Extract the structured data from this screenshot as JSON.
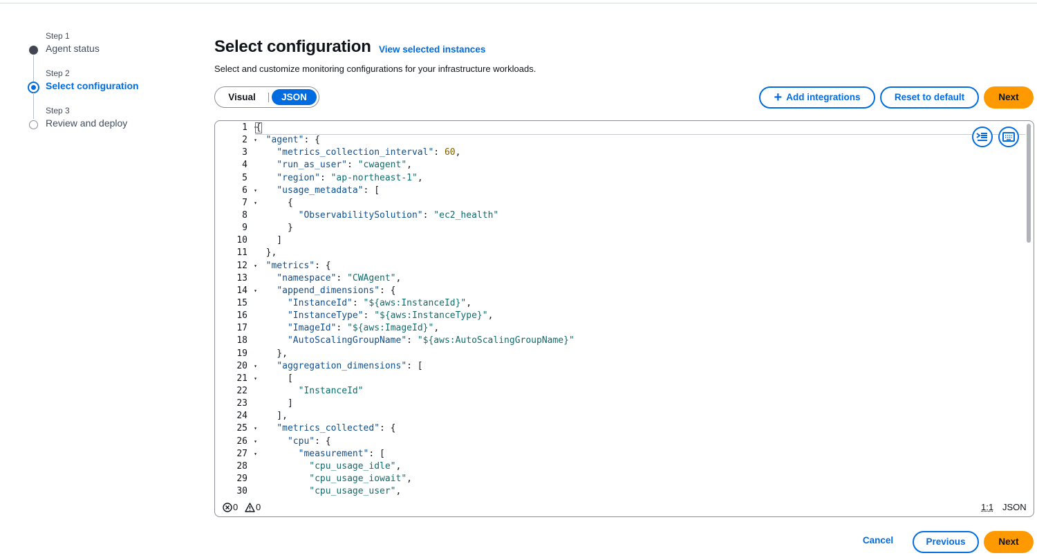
{
  "steps": [
    {
      "caption": "Step 1",
      "title": "Agent status"
    },
    {
      "caption": "Step 2",
      "title": "Select configuration"
    },
    {
      "caption": "Step 3",
      "title": "Review and deploy"
    }
  ],
  "header": {
    "title": "Select configuration",
    "link": "View selected instances",
    "description": "Select and customize monitoring configurations for your infrastructure workloads."
  },
  "toggle": {
    "visual": "Visual",
    "json": "JSON",
    "selected": "JSON"
  },
  "actions": {
    "add": "Add integrations",
    "reset": "Reset to default",
    "next": "Next"
  },
  "editor": {
    "line_numbers": [
      "1",
      "2",
      "3",
      "4",
      "5",
      "6",
      "7",
      "8",
      "9",
      "10",
      "11",
      "12",
      "13",
      "14",
      "15",
      "16",
      "17",
      "18",
      "19",
      "20",
      "21",
      "22",
      "23",
      "24",
      "25",
      "26",
      "27",
      "28",
      "29",
      "30"
    ],
    "foldable_lines": [
      1,
      2,
      6,
      7,
      12,
      14,
      20,
      21,
      25,
      26,
      27
    ],
    "lines": [
      "{",
      "  \"agent\": {",
      "    \"metrics_collection_interval\": 60,",
      "    \"run_as_user\": \"cwagent\",",
      "    \"region\": \"ap-northeast-1\",",
      "    \"usage_metadata\": [",
      "      {",
      "        \"ObservabilitySolution\": \"ec2_health\"",
      "      }",
      "    ]",
      "  },",
      "  \"metrics\": {",
      "    \"namespace\": \"CWAgent\",",
      "    \"append_dimensions\": {",
      "      \"InstanceId\": \"${aws:InstanceId}\",",
      "      \"InstanceType\": \"${aws:InstanceType}\",",
      "      \"ImageId\": \"${aws:ImageId}\",",
      "      \"AutoScalingGroupName\": \"${aws:AutoScalingGroupName}\"",
      "    },",
      "    \"aggregation_dimensions\": [",
      "      [",
      "        \"InstanceId\"",
      "      ]",
      "    ],",
      "    \"metrics_collected\": {",
      "      \"cpu\": {",
      "        \"measurement\": [",
      "          \"cpu_usage_idle\",",
      "          \"cpu_usage_iowait\",",
      "          \"cpu_usage_user\","
    ],
    "errors": "0",
    "warnings": "0",
    "position": "1:1",
    "language": "JSON",
    "scroll_fraction": 0.32
  },
  "footer": {
    "cancel": "Cancel",
    "previous": "Previous",
    "next": "Next"
  }
}
